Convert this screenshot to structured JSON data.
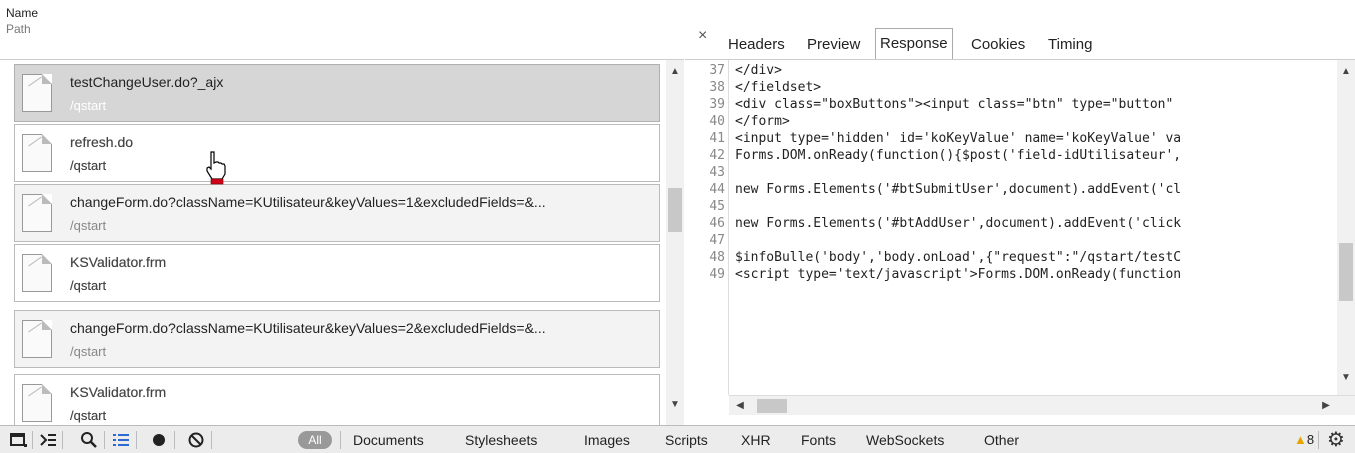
{
  "left": {
    "header_name": "Name",
    "header_path": "Path",
    "rows": [
      {
        "name": "testChangeUser.do?_ajx",
        "path": "/qstart"
      },
      {
        "name": "refresh.do",
        "path": "/qstart"
      },
      {
        "name": "changeForm.do?className=KUtilisateur&keyValues=1&excludedFields=&...",
        "path": "/qstart"
      },
      {
        "name": "KSValidator.frm",
        "path": "/qstart"
      },
      {
        "name": "changeForm.do?className=KUtilisateur&keyValues=2&excludedFields=&...",
        "path": "/qstart"
      },
      {
        "name": "KSValidator.frm",
        "path": "/qstart"
      }
    ]
  },
  "right": {
    "close_glyph": "×",
    "tabs": [
      "Headers",
      "Preview",
      "Response",
      "Cookies",
      "Timing"
    ],
    "active_tab": "Response",
    "line_numbers": [
      "37",
      "38",
      "39",
      "40",
      "41",
      "42",
      "43",
      "44",
      "45",
      "46",
      "47",
      "48",
      "49"
    ],
    "lines": [
      "</div>",
      "</fieldset>",
      "<div class=\"boxButtons\"><input class=\"btn\" type=\"button\"",
      "</form>",
      "<input type='hidden' id='koKeyValue' name='koKeyValue' va",
      "Forms.DOM.onReady(function(){$post('field-idUtilisateur',",
      "",
      "new Forms.Elements('#btSubmitUser',document).addEvent('cl",
      "",
      "new Forms.Elements('#btAddUser',document).addEvent('click",
      "",
      "$infoBulle('body','body.onLoad',{\"request\":\"/qstart/testC",
      "<script type='text/javascript'>Forms.DOM.onReady(function"
    ]
  },
  "toolbar": {
    "all_label": "All",
    "filters": [
      "Documents",
      "Stylesheets",
      "Images",
      "Scripts",
      "XHR",
      "Fonts",
      "WebSockets",
      "Other"
    ],
    "warning_count": "8",
    "icons": [
      "dock-icon",
      "console-icon",
      "search-icon",
      "list-icon",
      "record-icon",
      "clear-icon",
      "settings-icon"
    ]
  }
}
